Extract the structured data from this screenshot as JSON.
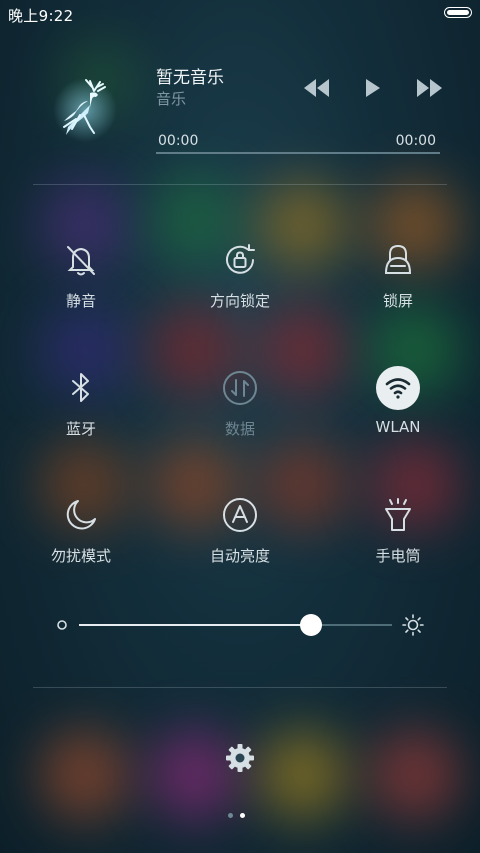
{
  "status_bar": {
    "time": "晚上9:22"
  },
  "music": {
    "title": "暂无音乐",
    "subtitle": "音乐",
    "time_current": "00:00",
    "time_total": "00:00",
    "progress": 0,
    "icons": {
      "album_art": "deer-icon",
      "previous": "rewind-icon",
      "play": "play-icon",
      "next": "fast-forward-icon"
    }
  },
  "toggles": [
    {
      "label": "静音",
      "icon": "bell-off-icon",
      "state": "off"
    },
    {
      "label": "方向锁定",
      "icon": "rotation-lock-icon",
      "state": "off"
    },
    {
      "label": "锁屏",
      "icon": "lock-icon",
      "state": "off"
    },
    {
      "label": "蓝牙",
      "icon": "bluetooth-icon",
      "state": "off"
    },
    {
      "label": "数据",
      "icon": "mobile-data-icon",
      "state": "disabled"
    },
    {
      "label": "WLAN",
      "icon": "wifi-icon",
      "state": "on"
    },
    {
      "label": "勿扰模式",
      "icon": "moon-icon",
      "state": "off"
    },
    {
      "label": "自动亮度",
      "icon": "auto-brightness-icon",
      "state": "off"
    },
    {
      "label": "手电筒",
      "icon": "flashlight-icon",
      "state": "off"
    }
  ],
  "brightness": {
    "level": 0.74,
    "icons": {
      "low": "brightness-low-icon",
      "high": "sun-icon"
    }
  },
  "settings": {
    "icon": "gear-icon"
  },
  "pager": {
    "count": 2,
    "active_index": 1
  },
  "colors": {
    "background": "#132e3b",
    "foreground": "#e6ecef",
    "muted": "#7f97a2",
    "disabled": "#6d8692",
    "wlan_active": "#e9eef0"
  }
}
